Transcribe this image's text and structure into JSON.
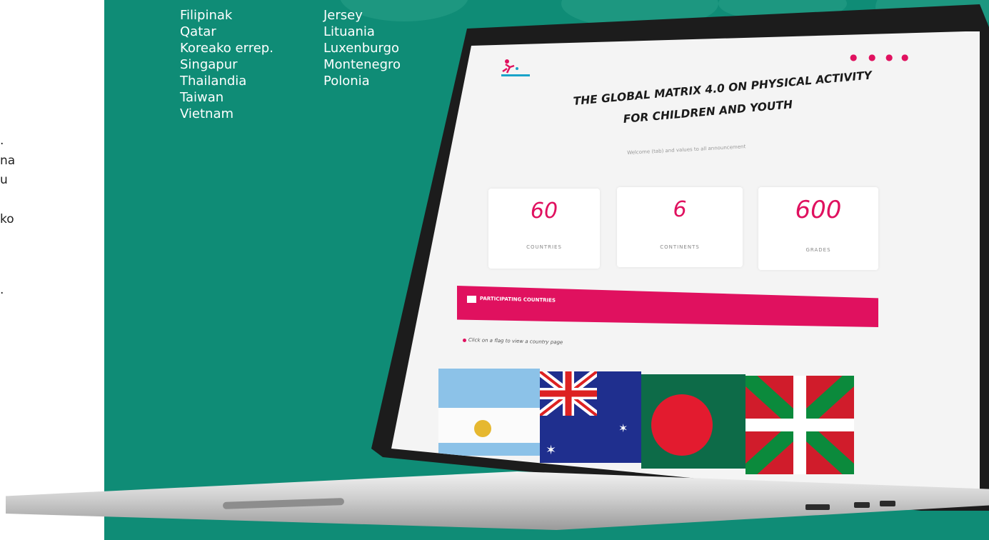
{
  "left_fragments": [
    ".",
    "na",
    "u",
    "ko",
    "."
  ],
  "countries_col1": [
    "Filipinak",
    "Qatar",
    "Koreako errep.",
    "Singapur",
    "Thailandia",
    "Taiwan",
    "Vietnam"
  ],
  "countries_col2": [
    "Jersey",
    "Lituania",
    "Luxenburgo",
    "Montenegro",
    "Polonia"
  ],
  "site": {
    "hero_line1": "THE GLOBAL MATRIX 4.0 ON PHYSICAL ACTIVITY",
    "hero_line2": "FOR CHILDREN AND YOUTH",
    "subtitle": "Welcome (tab) and values to all announcement",
    "stats": [
      {
        "value": "60",
        "label": "COUNTRIES"
      },
      {
        "value": "6",
        "label": "CONTINENTS"
      },
      {
        "value": "600",
        "label": "GRADES"
      }
    ],
    "band_title": "PARTICIPATING COUNTRIES",
    "hint": "Click on a flag to view a country page",
    "social_icons": [
      "twitter-icon",
      "linkedin-icon",
      "search-icon",
      "menu-icon"
    ]
  },
  "colors": {
    "panel_bg": "#0f8c76",
    "accent": "#e0115f",
    "screen_bg": "#f4f4f4"
  }
}
